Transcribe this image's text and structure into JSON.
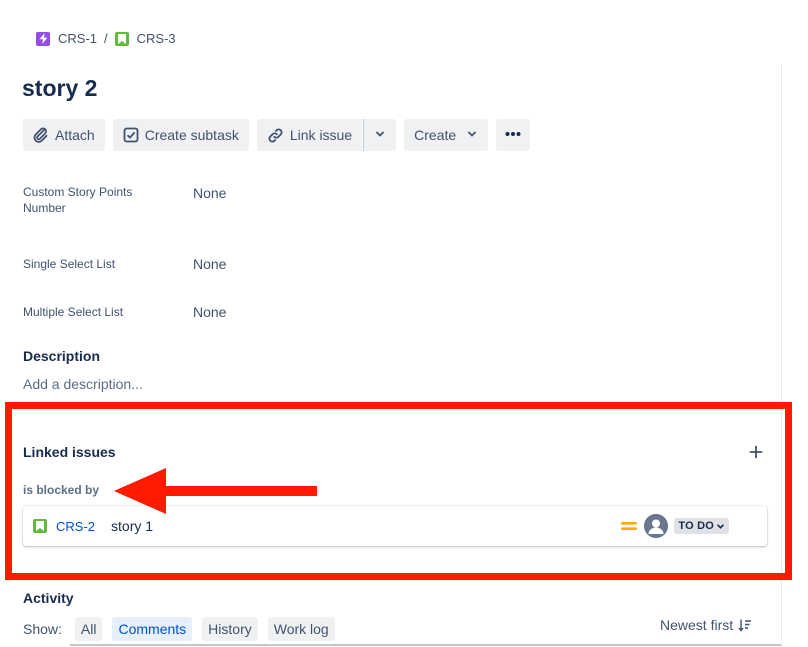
{
  "breadcrumb": {
    "parent": {
      "key": "CRS-1",
      "type_icon": "epic-lightning-icon",
      "color": "#904ee2"
    },
    "separator": "/",
    "current": {
      "key": "CRS-3",
      "type_icon": "story-bookmark-icon",
      "color": "#63ba3c"
    }
  },
  "issue": {
    "title": "story 2"
  },
  "toolbar": {
    "attach": "Attach",
    "create_subtask": "Create subtask",
    "link_issue": "Link issue",
    "create": "Create"
  },
  "fields": [
    {
      "label": "Custom Story Points Number",
      "value": "None"
    },
    {
      "label": "Single Select List",
      "value": "None"
    },
    {
      "label": "Multiple Select List",
      "value": "None"
    }
  ],
  "description": {
    "heading": "Description",
    "placeholder": "Add a description..."
  },
  "linked_issues": {
    "heading": "Linked issues",
    "link_type": "is blocked by",
    "items": [
      {
        "key": "CRS-2",
        "summary": "story 1",
        "type_icon": "story-bookmark-icon",
        "priority_icon": "priority-medium-icon",
        "priority_color": "#ffab00",
        "status": "TO DO"
      }
    ]
  },
  "annotation": {
    "highlight_color": "#ff1a00"
  },
  "activity": {
    "heading": "Activity",
    "show_label": "Show:",
    "filters": [
      {
        "label": "All",
        "active": false
      },
      {
        "label": "Comments",
        "active": true
      },
      {
        "label": "History",
        "active": false
      },
      {
        "label": "Work log",
        "active": false
      }
    ],
    "sort": "Newest first"
  }
}
